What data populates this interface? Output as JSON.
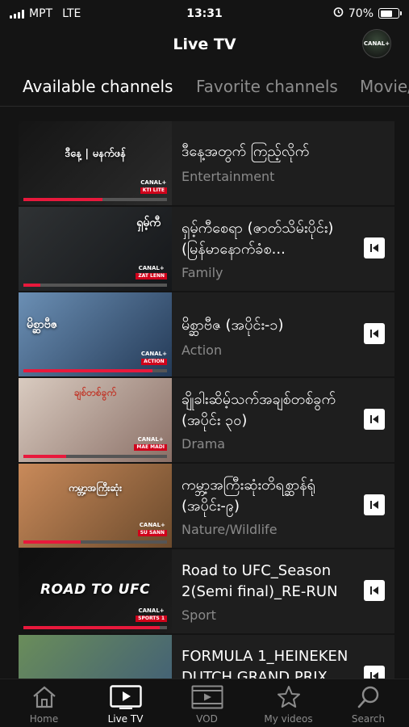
{
  "status_bar": {
    "carrier": "MPT",
    "network": "LTE",
    "time": "13:31",
    "battery": "70%",
    "battery_level": 0.7
  },
  "header": {
    "title": "Live TV",
    "avatar_text": "CANAL+"
  },
  "tabs": [
    {
      "label": "Available channels",
      "active": true
    },
    {
      "label": "Favorite channels",
      "active": false
    },
    {
      "label": "Movie/",
      "active": false
    }
  ],
  "channels": [
    {
      "title": "ဒီနေ့အတွက် ကြည့်လိုက်",
      "genre": "Entertainment",
      "thumb_caption": "ဒီနေ့  |  မနက်ဖန်",
      "badge_brand": "CANAL+",
      "badge_sub": "KTI LITE",
      "progress": 0.55,
      "has_restart": false,
      "thumb_colors": [
        "#151515",
        "#2b2b2b"
      ]
    },
    {
      "title": "ရှမ့်ကီစေရာ (ဇာတ်သိမ်းပိုင်း)(မြန်မာနောက်ခံစ...",
      "genre": "Family",
      "thumb_caption": "ရှမ့်ကီ",
      "badge_brand": "CANAL+",
      "badge_sub": "ZAT LENN",
      "progress": 0.12,
      "has_restart": true,
      "thumb_colors": [
        "#2f3234",
        "#15171a"
      ]
    },
    {
      "title": "မိစ္ဆာဗီဇ (အပိုင်း-၁)",
      "genre": "Action",
      "thumb_caption": "မိစ္ဆာဗီဇ",
      "badge_brand": "CANAL+",
      "badge_sub": "ACTION",
      "progress": 0.9,
      "has_restart": true,
      "thumb_colors": [
        "#6b8fb4",
        "#243a57"
      ]
    },
    {
      "title": "ချိုခါးဆိမ့်သက်အချစ်တစ်ခွက် (အပိုင်း ၃၀)",
      "genre": "Drama",
      "thumb_caption": "ချစ်တစ်ခွက်",
      "badge_brand": "CANAL+",
      "badge_sub": "MAE MADI",
      "progress": 0.3,
      "has_restart": true,
      "thumb_colors": [
        "#d9cbc0",
        "#8a6f66"
      ]
    },
    {
      "title": "ကမ္ဘာ့အကြီးဆုံးတိရစ္ဆာန်ရုံ (အပိုင်း-၉)",
      "genre": "Nature/Wildlife",
      "thumb_caption": "ကမ္ဘာ့အကြီးဆုံး",
      "badge_brand": "CANAL+",
      "badge_sub": "SU SANN",
      "progress": 0.4,
      "has_restart": true,
      "thumb_colors": [
        "#c98a5a",
        "#6b4a2c"
      ]
    },
    {
      "title": "Road to UFC_Season 2(Semi final)_RE-RUN",
      "genre": "Sport",
      "thumb_caption": "ROAD TO UFC",
      "badge_brand": "CANAL+",
      "badge_sub": "SPORTS 1",
      "progress": 0.95,
      "has_restart": true,
      "thumb_colors": [
        "#0f0f0f",
        "#1d1d1d"
      ]
    },
    {
      "title": "FORMULA 1_HEINEKEN DUTCH GRAND PRIX",
      "genre": "",
      "thumb_caption": "",
      "badge_brand": "",
      "badge_sub": "",
      "progress": 0,
      "has_restart": true,
      "thumb_colors": [
        "#6a8d5a",
        "#3d5a7a"
      ]
    }
  ],
  "bottom_nav": [
    {
      "label": "Home",
      "icon": "home-icon",
      "active": false
    },
    {
      "label": "Live TV",
      "icon": "tv-icon",
      "active": true
    },
    {
      "label": "VOD",
      "icon": "film-icon",
      "active": false
    },
    {
      "label": "My videos",
      "icon": "star-icon",
      "active": false
    },
    {
      "label": "Search",
      "icon": "search-icon",
      "active": false
    }
  ],
  "colors": {
    "accent": "#e8193c",
    "background": "#141414",
    "card": "#1e1e1e"
  }
}
